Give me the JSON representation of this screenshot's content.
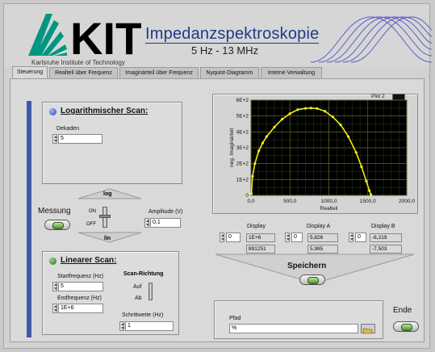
{
  "header": {
    "title": "Impedanzspektroskopie",
    "subtitle": "5 Hz - 13 MHz",
    "logo_text": "KIT",
    "institute": "Karlsruhe Institute of Technology"
  },
  "tabs": [
    {
      "label": "Steuerung",
      "active": true
    },
    {
      "label": "Realteil über Frequenz",
      "active": false
    },
    {
      "label": "Imaginärteil über Frequenz",
      "active": false
    },
    {
      "label": "Nyquist-Diagramm",
      "active": false
    },
    {
      "label": "Interne Verwaltung",
      "active": false
    }
  ],
  "log_scan": {
    "title": "Logarithmischer Scan:",
    "dekaden_label": "Dekaden",
    "dekaden_value": "5",
    "led_color": "#3a55c8"
  },
  "switch": {
    "top_label": "log",
    "bottom_label": "lin",
    "on_label": "ON",
    "off_label": "OFF"
  },
  "messung": {
    "label": "Messung"
  },
  "amplitude": {
    "label": "Amplitude (V)",
    "value": "0,1"
  },
  "lin_scan": {
    "title": "Linearer Scan:",
    "led_color": "#2e7d2e",
    "start_label": "Startfrequenz (Hz)",
    "start_value": "5",
    "end_label": "Endfrequenz (Hz)",
    "end_value": "1E+6",
    "richtung_label": "Scan-Richtung",
    "auf_label": "Auf",
    "ab_label": "Ab",
    "schritt_label": "Schrittweite (Hz)",
    "schritt_value": "1"
  },
  "plot": {
    "legend": "Plot 2",
    "xlabel": "Realteil",
    "ylabel": "neg. Imaginärteil",
    "trace_color": "#f2ee1a"
  },
  "chart_data": {
    "type": "scatter",
    "title": "",
    "xlabel": "Realteil",
    "ylabel": "neg. Imaginärteil",
    "xlim": [
      0,
      2000
    ],
    "ylim": [
      0,
      600
    ],
    "x_ticks": [
      "0,0",
      "500,0",
      "1000,0",
      "1500,0",
      "2000,0"
    ],
    "y_ticks": [
      "0",
      "1E+2",
      "2E+2",
      "3E+2",
      "4E+2",
      "5E+2",
      "6E+2"
    ],
    "grid": true,
    "series": [
      {
        "name": "Plot 2",
        "x": [
          5,
          20,
          50,
          100,
          150,
          200,
          300,
          400,
          500,
          600,
          700,
          770,
          850,
          950,
          1050,
          1150,
          1250,
          1350,
          1420,
          1480,
          1520,
          1540
        ],
        "y": [
          10,
          120,
          200,
          280,
          330,
          370,
          430,
          480,
          515,
          540,
          548,
          550,
          547,
          530,
          495,
          445,
          370,
          270,
          180,
          90,
          30,
          5
        ]
      }
    ]
  },
  "displays": [
    {
      "label": "Display",
      "index": "0",
      "values": [
        "1E+6",
        "891251"
      ]
    },
    {
      "label": "Display A",
      "index": "0",
      "values": [
        "5,826",
        "5,985"
      ]
    },
    {
      "label": "Display B",
      "index": "0",
      "values": [
        "-6,219",
        "-7,503"
      ]
    }
  ],
  "speichern": {
    "label": "Speichern"
  },
  "pfad": {
    "label": "Pfad",
    "value": "%"
  },
  "ende": {
    "label": "Ende"
  }
}
